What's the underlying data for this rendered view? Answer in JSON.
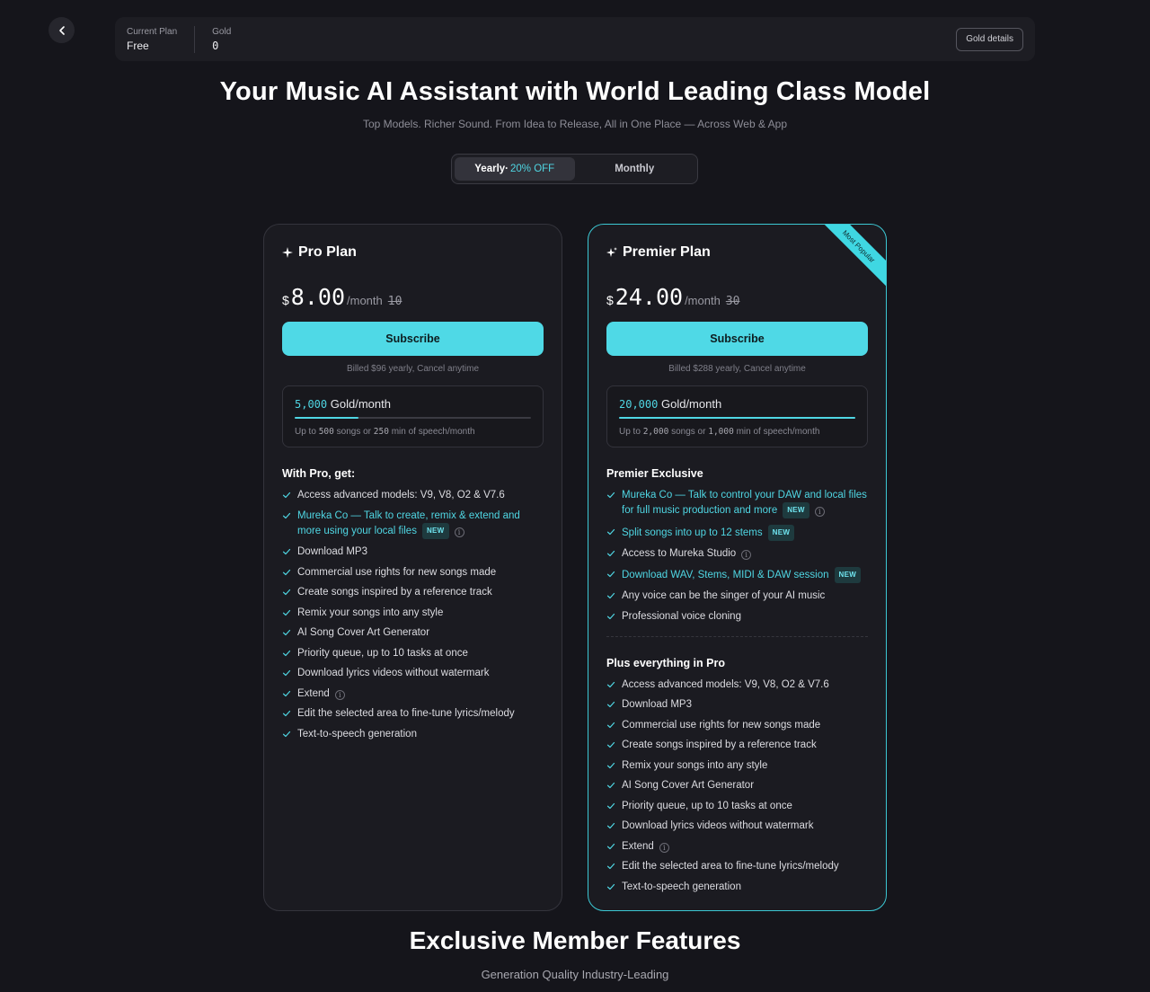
{
  "topbar": {
    "current_plan_label": "Current Plan",
    "current_plan_value": "Free",
    "gold_label": "Gold",
    "gold_value": "0",
    "gold_details": "Gold details"
  },
  "hero": {
    "title": "Your Music AI Assistant with World Leading Class Model",
    "subtitle": "Top Models. Richer Sound. From Idea to Release, All in One Place — Across Web & App"
  },
  "billing_toggle": {
    "yearly": "Yearly·",
    "discount": "20% OFF",
    "monthly": "Monthly",
    "selected": "yearly"
  },
  "pro": {
    "name": "Pro Plan",
    "currency": "$",
    "price": "8.00",
    "per": "/month",
    "old_price": "10",
    "subscribe": "Subscribe",
    "billed": "Billed $96 yearly, Cancel anytime",
    "gold_amount": "5,000",
    "gold_unit": "Gold/month",
    "gold_fill": 0.27,
    "songs_prefix": "Up to ",
    "songs": "500",
    "songs_mid": " songs or ",
    "speech": "250",
    "speech_suffix": " min of speech/month",
    "section_title": "With Pro, get:",
    "features": [
      {
        "text": "Access advanced models: V9, V8, O2 & V7.6"
      },
      {
        "text": "Mureka Co — Talk to create, remix & extend and more using your local files",
        "highlight": true,
        "badge": "NEW",
        "info": true
      },
      {
        "text": "Download MP3"
      },
      {
        "text": "Commercial use rights for new songs made"
      },
      {
        "text": "Create songs inspired by a reference track"
      },
      {
        "text": "Remix your songs into any style"
      },
      {
        "text": "AI Song Cover Art Generator"
      },
      {
        "text": "Priority queue, up to 10 tasks at once"
      },
      {
        "text": "Download lyrics videos without watermark"
      },
      {
        "text": "Extend",
        "info": true
      },
      {
        "text": "Edit the selected area to fine-tune lyrics/melody"
      },
      {
        "text": "Text-to-speech generation"
      }
    ]
  },
  "premier": {
    "ribbon": "Most Popular",
    "name": "Premier Plan",
    "currency": "$",
    "price": "24.00",
    "per": "/month",
    "old_price": "30",
    "subscribe": "Subscribe",
    "billed": "Billed $288 yearly, Cancel anytime",
    "gold_amount": "20,000",
    "gold_unit": "Gold/month",
    "gold_fill": 1.0,
    "songs_prefix": "Up to ",
    "songs": "2,000",
    "songs_mid": " songs or ",
    "speech": "1,000",
    "speech_suffix": " min of speech/month",
    "section_title": "Premier Exclusive",
    "features": [
      {
        "text": "Mureka Co — Talk to control your DAW and local files for full music production and more",
        "highlight": true,
        "badge": "NEW",
        "info": true
      },
      {
        "text": "Split songs into up to 12 stems",
        "highlight": true,
        "badge": "NEW"
      },
      {
        "text": "Access to Mureka Studio",
        "info": true
      },
      {
        "text": "Download WAV, Stems, MIDI & DAW session",
        "highlight": true,
        "badge": "NEW"
      },
      {
        "text": "Any voice can be the singer of your AI music"
      },
      {
        "text": "Professional voice cloning"
      }
    ],
    "section2_title": "Plus everything in Pro",
    "features2": [
      {
        "text": "Access advanced models: V9, V8, O2 & V7.6"
      },
      {
        "text": "Download MP3"
      },
      {
        "text": "Commercial use rights for new songs made"
      },
      {
        "text": "Create songs inspired by a reference track"
      },
      {
        "text": "Remix your songs into any style"
      },
      {
        "text": "AI Song Cover Art Generator"
      },
      {
        "text": "Priority queue, up to 10 tasks at once"
      },
      {
        "text": "Download lyrics videos without watermark"
      },
      {
        "text": "Extend",
        "info": true
      },
      {
        "text": "Edit the selected area to fine-tune lyrics/melody"
      },
      {
        "text": "Text-to-speech generation"
      }
    ]
  },
  "footer": {
    "title": "Exclusive Member Features",
    "subtitle": "Generation Quality Industry-Leading"
  },
  "colors": {
    "accent": "#4fd9e6",
    "background": "#15151b",
    "card": "#1b1b21"
  }
}
